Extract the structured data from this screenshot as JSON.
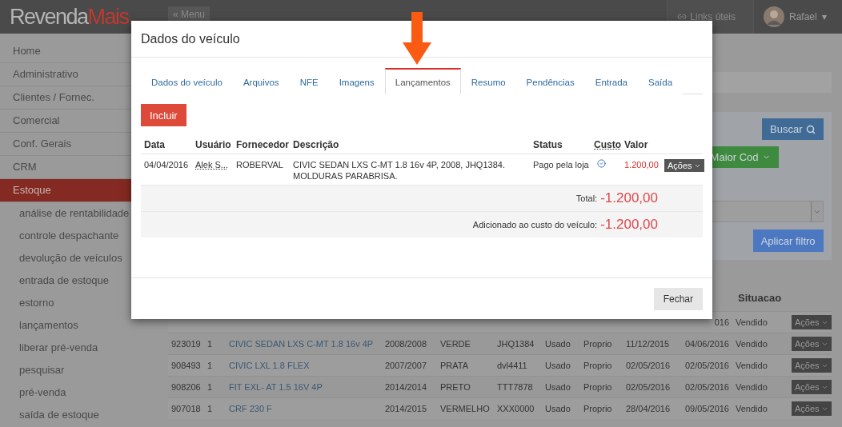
{
  "topbar": {
    "logo": {
      "part1": "Revenda",
      "part2": "Mais"
    },
    "menu_button": "« Menu",
    "links_button": "Links úteis",
    "user": {
      "name": "Rafael",
      "caret": "▾"
    }
  },
  "sidebar": {
    "items": [
      {
        "label": "Home",
        "selected": false
      },
      {
        "label": "Administrativo",
        "selected": false
      },
      {
        "label": "Clientes / Fornec.",
        "selected": false
      },
      {
        "label": "Comercial",
        "selected": false
      },
      {
        "label": "Conf. Gerais",
        "selected": false
      },
      {
        "label": "CRM",
        "selected": false
      },
      {
        "label": "Estoque",
        "selected": true,
        "children": [
          {
            "label": "análise de rentabilidade"
          },
          {
            "label": "controle despachante"
          },
          {
            "label": "devolução de veículos"
          },
          {
            "label": "entrada de estoque"
          },
          {
            "label": "estorno"
          },
          {
            "label": "lançamentos"
          },
          {
            "label": "liberar pré-venda"
          },
          {
            "label": "pesquisar"
          },
          {
            "label": "pré-venda"
          },
          {
            "label": "saída de estoque"
          }
        ]
      }
    ]
  },
  "filters": {
    "search_button": "Buscar",
    "sort_button": "Maior Cod",
    "apply_button": "Aplicar filtro"
  },
  "stock_table": {
    "columns": {
      "situacao": "Situacao"
    },
    "rows": [
      {
        "saida": "016",
        "situacao": "Vendido",
        "action": "Ações"
      },
      {
        "codigo": "923019",
        "qtd": "1",
        "modelo": "CIVIC SEDAN LXS C-MT 1.8 16v 4P",
        "ano": "2008/2008",
        "cor": "VERDE",
        "placa": "JHQ1384",
        "tipo": "Usado",
        "origem": "Proprio",
        "entrada": "11/12/2015",
        "saida": "04/06/2016",
        "situacao": "Vendido",
        "action": "Ações"
      },
      {
        "codigo": "908493",
        "qtd": "1",
        "modelo": "CIVIC LXL 1.8 FLEX",
        "ano": "2007/2007",
        "cor": "PRATA",
        "placa": "dvl4411",
        "tipo": "Usado",
        "origem": "Proprio",
        "entrada": "02/05/2016",
        "saida": "02/05/2016",
        "situacao": "Vendido",
        "action": "Ações"
      },
      {
        "codigo": "908206",
        "qtd": "1",
        "modelo": "FIT EXL- AT 1.5 16V 4P",
        "ano": "2014/2014",
        "cor": "PRETO",
        "placa": "TTT7878",
        "tipo": "Usado",
        "origem": "Proprio",
        "entrada": "02/05/2016",
        "saida": "02/05/2016",
        "situacao": "Vendido",
        "action": "Ações"
      },
      {
        "codigo": "907018",
        "qtd": "1",
        "modelo": "CRF 230 F",
        "ano": "2014/2015",
        "cor": "VERMELHO",
        "placa": "XXX0000",
        "tipo": "Usado",
        "origem": "Proprio",
        "entrada": "28/04/2016",
        "saida": "09/05/2016",
        "situacao": "Vendido",
        "action": "Ações"
      }
    ]
  },
  "modal": {
    "title": "Dados do veículo",
    "tabs": [
      {
        "label": "Dados do veículo",
        "selected": false
      },
      {
        "label": "Arquivos",
        "selected": false
      },
      {
        "label": "NFE",
        "selected": false
      },
      {
        "label": "Imagens",
        "selected": false
      },
      {
        "label": "Lançamentos",
        "selected": true
      },
      {
        "label": "Resumo",
        "selected": false
      },
      {
        "label": "Pendências",
        "selected": false
      },
      {
        "label": "Entrada",
        "selected": false
      },
      {
        "label": "Saída",
        "selected": false
      }
    ],
    "add_button": "Incluir",
    "table": {
      "columns": [
        "Data",
        "Usuário",
        "Fornecedor",
        "Descrição",
        "Status",
        "Custo",
        "Valor"
      ],
      "rows": [
        {
          "data": "04/04/2016",
          "usuario": "Alek S...",
          "fornecedor": "ROBERVAL",
          "descricao": "CIVIC SEDAN LXS C-MT 1.8 16v 4P, 2008, JHQ1384. MOLDURAS PARABRISA.",
          "status": "Pago pela loja",
          "custo": true,
          "valor": "1.200,00",
          "action": "Ações"
        }
      ]
    },
    "totals": [
      {
        "label": "Total:",
        "value": "-1.200,00"
      },
      {
        "label": "Adicionado ao custo do veículo:",
        "value": "-1.200,00"
      }
    ],
    "close_button": "Fechar"
  }
}
